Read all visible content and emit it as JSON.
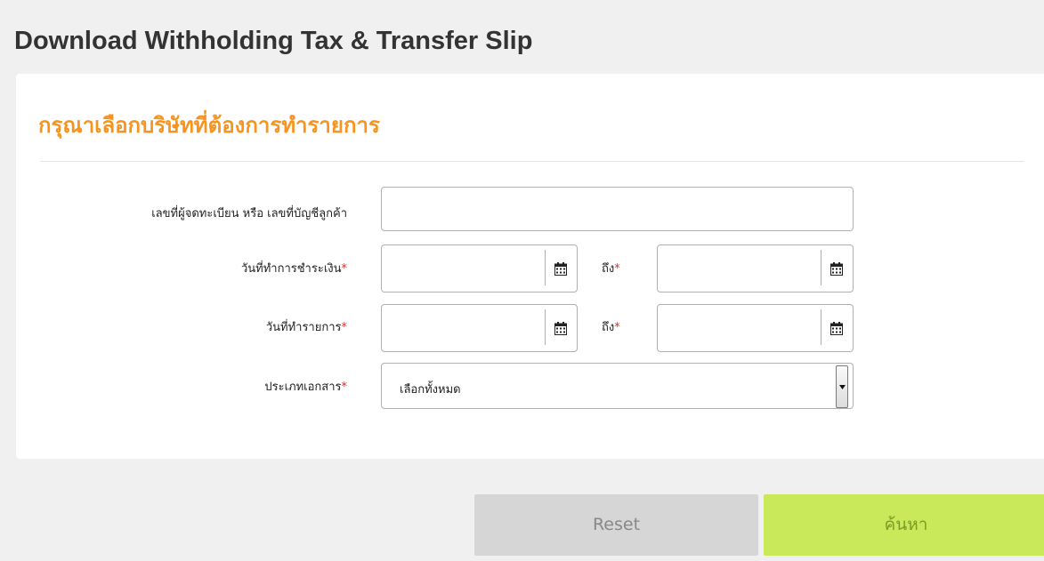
{
  "page": {
    "title": "Download Withholding Tax & Transfer Slip"
  },
  "form": {
    "heading": "กรุณาเลือกบริษัทที่ต้องการทำรายการ",
    "account": {
      "label": "เลขที่ผู้จดทะเบียน หรือ เลขที่บัญชีลูกค้า",
      "value": ""
    },
    "payment_date": {
      "label": "วันที่ทำการชำระเงิน",
      "from_value": "",
      "to_label": "ถึง",
      "to_value": ""
    },
    "transaction_date": {
      "label": "วันที่ทำรายการ",
      "from_value": "",
      "to_label": "ถึง",
      "to_value": ""
    },
    "document_type": {
      "label": "ประเภทเอกสาร",
      "selected": "เลือกทั้งหมด"
    },
    "required_mark": "*"
  },
  "buttons": {
    "reset_label": "Reset",
    "search_label": "ค้นหา"
  },
  "icons": {
    "calendar": "calendar-icon",
    "dropdown": "chevron-down-icon"
  },
  "colors": {
    "heading": "#f7941d",
    "required": "#d9302c",
    "search_button": "#c9e85a",
    "reset_button": "#d6d6d6"
  }
}
